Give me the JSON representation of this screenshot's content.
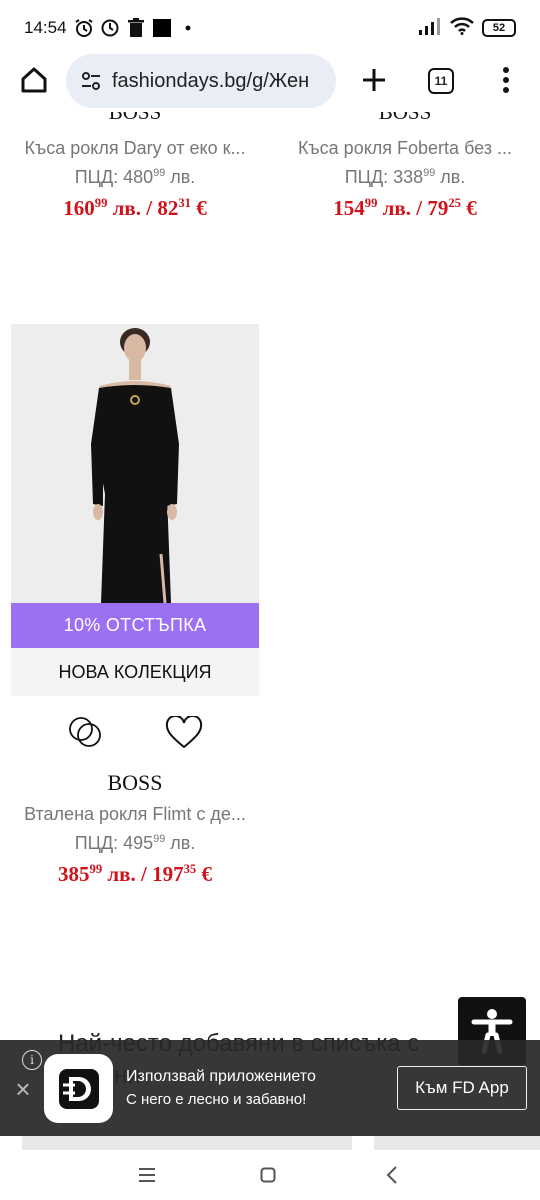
{
  "status": {
    "time": "14:54",
    "battery": "52"
  },
  "browser": {
    "url": "fashiondays.bg/g/Жен",
    "tab_count": "11"
  },
  "products_top": [
    {
      "brand": "BOSS",
      "name": "Къса рокля Dary от еко к...",
      "rrp_label": "ПЦД:",
      "rrp_int": "480",
      "rrp_dec": "99",
      "rrp_unit": "лв.",
      "price_int": "160",
      "price_dec": "99",
      "price_mid": "лв. / 82",
      "price_dec2": "31",
      "price_cur": "€"
    },
    {
      "brand": "BOSS",
      "name": "Къса рокля Foberta без ...",
      "rrp_label": "ПЦД:",
      "rrp_int": "338",
      "rrp_dec": "99",
      "rrp_unit": "лв.",
      "price_int": "154",
      "price_dec": "99",
      "price_mid": "лв. / 79",
      "price_dec2": "25",
      "price_cur": "€"
    }
  ],
  "product_card": {
    "discount_badge": "10% ОТСТЪПКА",
    "collection_badge": "НОВА КОЛЕКЦИЯ",
    "brand": "BOSS",
    "name": "Вталена рокля Flimt с де...",
    "rrp_label": "ПЦД:",
    "rrp_int": "495",
    "rrp_dec": "99",
    "rrp_unit": "лв.",
    "price_int": "385",
    "price_dec": "99",
    "price_mid": "лв. / 197",
    "price_dec2": "35",
    "price_cur": "€"
  },
  "section_heading": "Най-често добавяни в списъка с желани",
  "app_banner": {
    "line1": "Използвай приложението",
    "line2": "С него е лесно и забавно!",
    "cta": "Към FD App"
  },
  "colors": {
    "price_red": "#d0121b",
    "discount_purple": "#9b70f2",
    "banner_bg": "#282828"
  }
}
